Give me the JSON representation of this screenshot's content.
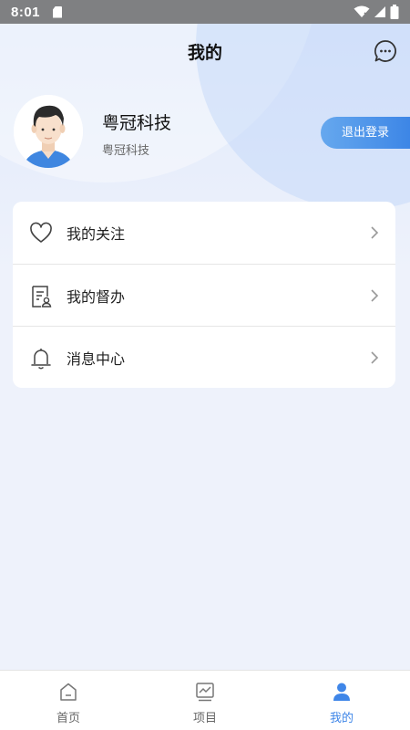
{
  "status_bar": {
    "time": "8:01"
  },
  "header": {
    "title": "我的"
  },
  "profile": {
    "name": "粤冠科技",
    "subtitle": "粤冠科技",
    "logout_label": "退出登录"
  },
  "menu": [
    {
      "label": "我的关注",
      "icon": "heart-icon"
    },
    {
      "label": "我的督办",
      "icon": "supervise-document-icon"
    },
    {
      "label": "消息中心",
      "icon": "bell-icon"
    }
  ],
  "tabs": [
    {
      "label": "首页",
      "icon": "home-icon",
      "active": false
    },
    {
      "label": "项目",
      "icon": "project-chart-icon",
      "active": false
    },
    {
      "label": "我的",
      "icon": "person-icon",
      "active": true
    }
  ],
  "colors": {
    "accent": "#3f86e8",
    "background": "#eef2fb",
    "status_bar": "#7f8082"
  }
}
